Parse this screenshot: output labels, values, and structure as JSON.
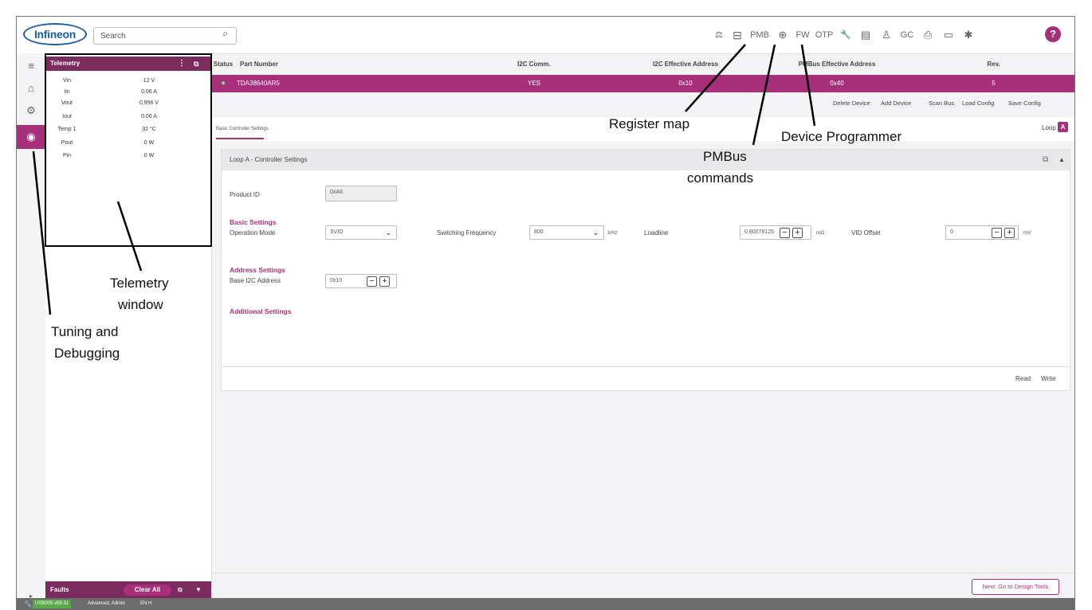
{
  "topbar": {
    "logo": "Infineon",
    "search_placeholder": "Search",
    "toolbar": [
      {
        "name": "balance-icon",
        "glyph": "⚖"
      },
      {
        "name": "register-map-icon",
        "glyph": "⊟"
      },
      {
        "name": "pmbus-icon",
        "glyph": "PMB"
      },
      {
        "name": "chip-icon",
        "glyph": "⊕"
      },
      {
        "name": "fw-icon",
        "glyph": "FW"
      },
      {
        "name": "otp-icon",
        "glyph": "OTP"
      },
      {
        "name": "wrench-icon",
        "glyph": "🔧"
      },
      {
        "name": "document-icon",
        "glyph": "▤"
      },
      {
        "name": "hierarchy-icon",
        "glyph": "♙"
      },
      {
        "name": "gc-icon",
        "glyph": "GC"
      },
      {
        "name": "print-icon",
        "glyph": "⎙"
      },
      {
        "name": "monitor-icon",
        "glyph": "▭"
      },
      {
        "name": "gear-icon",
        "glyph": "✱"
      }
    ],
    "help": "?"
  },
  "telemetry": {
    "title": "Telemetry",
    "rows": [
      {
        "name": "Vin",
        "value": "12 V"
      },
      {
        "name": "Iin",
        "value": "0.06 A"
      },
      {
        "name": "Vout",
        "value": "0.996 V"
      },
      {
        "name": "Iout",
        "value": "0.06 A"
      },
      {
        "name": "Temp 1",
        "value": "32 °C"
      },
      {
        "name": "Pout",
        "value": "0 W"
      },
      {
        "name": "Pin",
        "value": "0 W"
      }
    ]
  },
  "faults": {
    "title": "Faults",
    "clear": "Clear All"
  },
  "statusbar": {
    "usb": "USB005 v59.31",
    "user": "Advanced, Admin",
    "lang": "EN H"
  },
  "device_table": {
    "headers": [
      "Status",
      "Part Number",
      "I2C Comm.",
      "I2C Effective Address",
      "PMBus Effective Address",
      "Rev."
    ],
    "row": {
      "part": "TDA38640AR5",
      "comm": "YES",
      "i2c": "0x10",
      "pmbus": "0x40",
      "rev": "5"
    }
  },
  "actions": [
    "Delete Device",
    "Add Device",
    "Scan Bus",
    "Load Config",
    "Save Config"
  ],
  "tabs": {
    "active": "Basic Controller Settings",
    "loop_label": "Loop",
    "loop_value": "A"
  },
  "panel": {
    "title": "Loop A - Controller Settings",
    "product_id_label": "Product ID",
    "product_id": "0xA6",
    "basic_title": "Basic Settings",
    "operation_mode_label": "Operation Mode",
    "operation_mode": "SVID",
    "sw_freq_label": "Switching Frequency",
    "sw_freq": "800",
    "sw_freq_unit": "kHz",
    "loadline_label": "Loadline",
    "loadline": "0.80078125",
    "loadline_unit": "mΩ",
    "vid_offset_label": "VID Offset",
    "vid_offset": "0",
    "vid_offset_unit": "mV",
    "address_title": "Address Settings",
    "base_addr_label": "Base I2C Address",
    "base_addr": "0x10",
    "additional_title": "Additional Settings",
    "read": "Read",
    "write": "Write"
  },
  "next_button": "Next: Go to Design Tools",
  "annotations": {
    "register_map": "Register map",
    "pmbus_l1": "PMBus",
    "pmbus_l2": "commands",
    "device_programmer": "Device Programmer",
    "telemetry_l1": "Telemetry",
    "telemetry_l2": "window",
    "tuning_l1": "Tuning and",
    "tuning_l2": "Debugging"
  }
}
